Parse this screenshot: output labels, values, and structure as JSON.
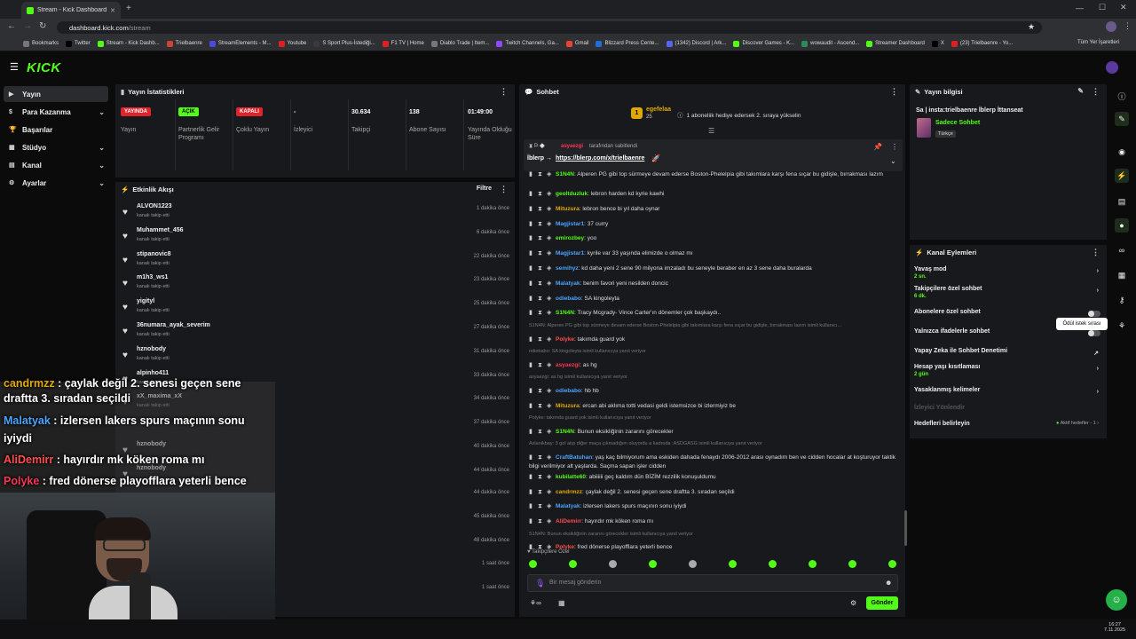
{
  "browser": {
    "tab_title": "Stream - Kick Dashboard",
    "url_host": "dashboard.kick.com",
    "url_path": "/stream",
    "bookmarks": [
      "Bookmarks",
      "Twitter",
      "Stream - Kick Dashb...",
      "Trielbaenre",
      "StreamElements - M...",
      "Youtube",
      "S Sport Plus-İstediği...",
      "F1 TV | Home",
      "Diablo Trade | Item...",
      "Twitch Channels, Ga...",
      "Gmail",
      "Blizzard Press Cente...",
      "(1342) Discord | Ark...",
      "Discover Games - K...",
      "wowaudit - Ascend...",
      "Streamer Dashboard",
      "X",
      "(23) Trielbaenre - Yo..."
    ],
    "all_bookmarks": "Tüm Yer İşaretleri"
  },
  "sidebar": {
    "items": [
      {
        "label": "Yayın"
      },
      {
        "label": "Para Kazanma"
      },
      {
        "label": "Başarılar"
      },
      {
        "label": "Stüdyo"
      },
      {
        "label": "Kanal"
      },
      {
        "label": "Ayarlar"
      }
    ]
  },
  "stats": {
    "title": "Yayın İstatistikleri",
    "items": [
      {
        "badge": "YAYINDA",
        "badge_color": "#e0242b",
        "label": "Yayın"
      },
      {
        "badge": "AÇIK",
        "badge_color": "#53fc18",
        "label": "Partnerlik Gelir Programı"
      },
      {
        "badge": "KAPALI",
        "badge_color": "#e0242b",
        "label": "Çoklu Yayın"
      },
      {
        "value": "-",
        "label": "İzleyici"
      },
      {
        "value": "30.634",
        "label": "Takipçi"
      },
      {
        "value": "138",
        "label": "Abone Sayısı"
      },
      {
        "value": "01:49:00",
        "label": "Yayında Olduğu Süre"
      }
    ]
  },
  "events": {
    "title": "Etkinlik Akışı",
    "filter": "Filtre",
    "items": [
      {
        "name": "ALVON1223",
        "sub": "kanalı takip etti",
        "time": "1 dakika önce"
      },
      {
        "name": "Muhammet_456",
        "sub": "kanalı takip etti",
        "time": "6 dakika önce"
      },
      {
        "name": "stipanovic8",
        "sub": "kanalı takip etti",
        "time": "22 dakika önce"
      },
      {
        "name": "m1h3_ws1",
        "sub": "kanalı takip etti",
        "time": "23 dakika önce"
      },
      {
        "name": "yigityl",
        "sub": "kanalı takip etti",
        "time": "25 dakika önce"
      },
      {
        "name": "36numara_ayak_severim",
        "sub": "kanalı takip etti",
        "time": "27 dakika önce"
      },
      {
        "name": "hznobody",
        "sub": "kanalı takip etti",
        "time": "31 dakika önce"
      },
      {
        "name": "alpinho411",
        "sub": "kanalı takip etti",
        "time": "33 dakika önce"
      },
      {
        "name": "xX_maxima_xX",
        "sub": "kanalı takip etti",
        "time": "34 dakika önce"
      },
      {
        "name": "",
        "sub": "",
        "time": "37 dakika önce"
      },
      {
        "name": "hznobody",
        "sub": "",
        "time": "40 dakika önce"
      },
      {
        "name": "hznobody",
        "sub": "",
        "time": "44 dakika önce"
      }
    ],
    "extra_times": [
      "44 dakika önce",
      "45 dakika önce",
      "48 dakika önce",
      "1 saat önce",
      "1 saat önce"
    ]
  },
  "overlay_chat": [
    {
      "user": "candrmzz",
      "color": "#e0a800",
      "text": "çaylak değil 2. senesi geçen sene"
    },
    {
      "user": "",
      "color": "#ffffff",
      "text": "draftta 3. sıradan seçildi"
    },
    {
      "user": "Malatyak",
      "color": "#4aa3ff",
      "text": "izlersen lakers spurs maçının sonu"
    },
    {
      "user": "",
      "color": "#ffffff",
      "text": "iyiydi"
    },
    {
      "user": "AliDemirr",
      "color": "#ff4c4c",
      "text": "hayırdır mk köken roma mı"
    },
    {
      "user": "Polyke",
      "color": "#ff3355",
      "text": "fred dönerse playofflara yeterli bence"
    }
  ],
  "chat": {
    "title": "Sohbet",
    "gift_user": "egefelaa",
    "gift_count": "25",
    "gift_text": "1 aboneliik hediye edersek 2. sıraya yükselin",
    "pinned_by": "asyaezgi",
    "pinned_by_suffix": "tarafından sabitlendi",
    "pinned_text": "İblerp →",
    "pinned_link": "https://blerp.com/x/trielbaenre",
    "messages": [
      {
        "type": "msg",
        "user": "S1N4N",
        "color": "#53fc18",
        "text": "Alperen PG gibi top sürmeye devam ederse Boston-Phelelpia gibi takımlara karşı fena sıçar bu gidişle, bırrakması lazım"
      },
      {
        "type": "msg",
        "user": "geoltduzluk",
        "color": "#53fc18",
        "text": "lebron harden kd kyrie kawhi"
      },
      {
        "type": "msg",
        "user": "Mituzura",
        "color": "#e0a800",
        "text": "lebron bence bi yıl daha oynar"
      },
      {
        "type": "msg",
        "user": "Magjistar1",
        "color": "#4aa3ff",
        "text": "37 curry"
      },
      {
        "type": "msg",
        "user": "emirozbey",
        "color": "#53fc18",
        "text": "yoo"
      },
      {
        "type": "msg",
        "user": "Magjistar1",
        "color": "#4aa3ff",
        "text": "kyrile var 33 yaşında elimizde o olmaz mı"
      },
      {
        "type": "msg",
        "user": "semihyz",
        "color": "#4aa3ff",
        "text": "kd daha yeni 2 sene 90 milyona imzaladı bu seneyle beraber en az 3 sene daha buralarda"
      },
      {
        "type": "msg",
        "user": "Malatyak",
        "color": "#4aa3ff",
        "text": "benim favori yeni nesilden doncic"
      },
      {
        "type": "msg",
        "user": "odiebabo",
        "color": "#4aa3ff",
        "text": "SA kingoleyta"
      },
      {
        "type": "msg",
        "user": "S1N4N",
        "color": "#53fc18",
        "text": "Tracy Mcgrady- Vince Carter'ın dönemler çok başkaydı.."
      },
      {
        "type": "reply",
        "text": "S1N4N: Alperen PG gibi top sürmeye devam ederse Boston-Phelelpia gibi takımlara karşı fena sıçar bu gidişle, bırrakması lazım isimli kullanıcı..."
      },
      {
        "type": "msg",
        "user": "Polyke",
        "color": "#ff4c4c",
        "text": "takımda guard yok"
      },
      {
        "type": "reply",
        "text": "odiebabo: SA kingoleyta isimli kullanıcıya yanıt veriyor"
      },
      {
        "type": "msg",
        "user": "asyaezgi",
        "color": "#ff3355",
        "text": "as hg"
      },
      {
        "type": "reply",
        "text": "asyaezgi: as hg isimli kullanıcıya yanıt veriyor"
      },
      {
        "type": "msg",
        "user": "odiebabo",
        "color": "#4aa3ff",
        "text": "hb hb"
      },
      {
        "type": "msg",
        "user": "Mituzura",
        "color": "#e0a800",
        "text": "ercan abi aklıma totti vedasi geldi istemsizce bi izlermiyiz be"
      },
      {
        "type": "reply",
        "text": "Polyke: takımda guard yok isimli kullanıcıya yanıt veriyor"
      },
      {
        "type": "msg",
        "user": "S1N4N",
        "color": "#53fc18",
        "text": "Bunun eksikliğinin zararını görecekler"
      },
      {
        "type": "reply",
        "text": "Aslanikbay: 3 gol atıp diğer maça çıkmadığım oluyordu a kadroda :ASDGASG isimli kullanıcıya yanıt veriyor"
      },
      {
        "type": "msg",
        "user": "CraftBatuhan",
        "color": "#4aa3ff",
        "text": "yaş kaç bilmiyorum ama eskiden dahada fenaydı 2006-2012 arası oynadım ben ve cidden hocalar at koşturuyor taktik bilgi verilmiyor alt yaşlarda. Saçma sapan işler cidden"
      },
      {
        "type": "msg",
        "user": "kubilatte60",
        "color": "#53fc18",
        "text": "abiiiiii geç kaldım dün BİZİM rezzilik konuşuldumu"
      },
      {
        "type": "msg",
        "user": "candrmzz",
        "color": "#e0a800",
        "text": "çaylak değil 2. senesi geçen sene draftta 3. sıradan seçildi"
      },
      {
        "type": "msg",
        "user": "Malatyak",
        "color": "#4aa3ff",
        "text": "izlersen lakers spurs maçının sonu iyiydi"
      },
      {
        "type": "msg",
        "user": "AliDemirr",
        "color": "#ff4c4c",
        "text": "hayırdır mk köken roma mı"
      },
      {
        "type": "reply",
        "text": "S1N4N: Bunun eksikliğinin zararını görecekler isimli kullanıcıya yanıt veriyor"
      },
      {
        "type": "msg",
        "user": "Polyke",
        "color": "#ff4c4c",
        "text": "fred dönerse playofflara yeterli bence"
      }
    ],
    "followers_only": "Takipçilere Özel",
    "input_placeholder": "Bir mesaj gönderin",
    "send": "Gönder"
  },
  "stream_info": {
    "title": "Yayın bilgisi",
    "stream_title": "Sa | insta:trielbaenre İblerp İttanseat",
    "category": "Sadece Sohbet",
    "language": "Türkçe"
  },
  "channel_actions": {
    "title": "Kanal Eylemleri",
    "items": [
      {
        "label": "Yavaş mod",
        "sub": "2 sn."
      },
      {
        "label": "Takipçilere özel sohbet",
        "sub": "6 dk."
      },
      {
        "label": "Abonelere özel sohbet",
        "sub": ""
      },
      {
        "label": "Yalnızca ifadelerle sohbet",
        "sub": ""
      },
      {
        "label": "Yapay Zeka ile Sohbet Denetimi",
        "sub": ""
      },
      {
        "label": "Hesap yaşı kısıtlaması",
        "sub": "2 gün"
      },
      {
        "label": "Yasaklanmış kelimeler",
        "sub": ""
      },
      {
        "label": "İzleyici Yönlendir",
        "sub": ""
      },
      {
        "label": "Hedefleri belirleyin",
        "sub": ""
      }
    ],
    "goals_status": "Aktif hedefler - 1",
    "tooltip": "Ödül istek sırası"
  },
  "taskbar": {
    "time": "16:27",
    "date": "7.11.2025"
  }
}
